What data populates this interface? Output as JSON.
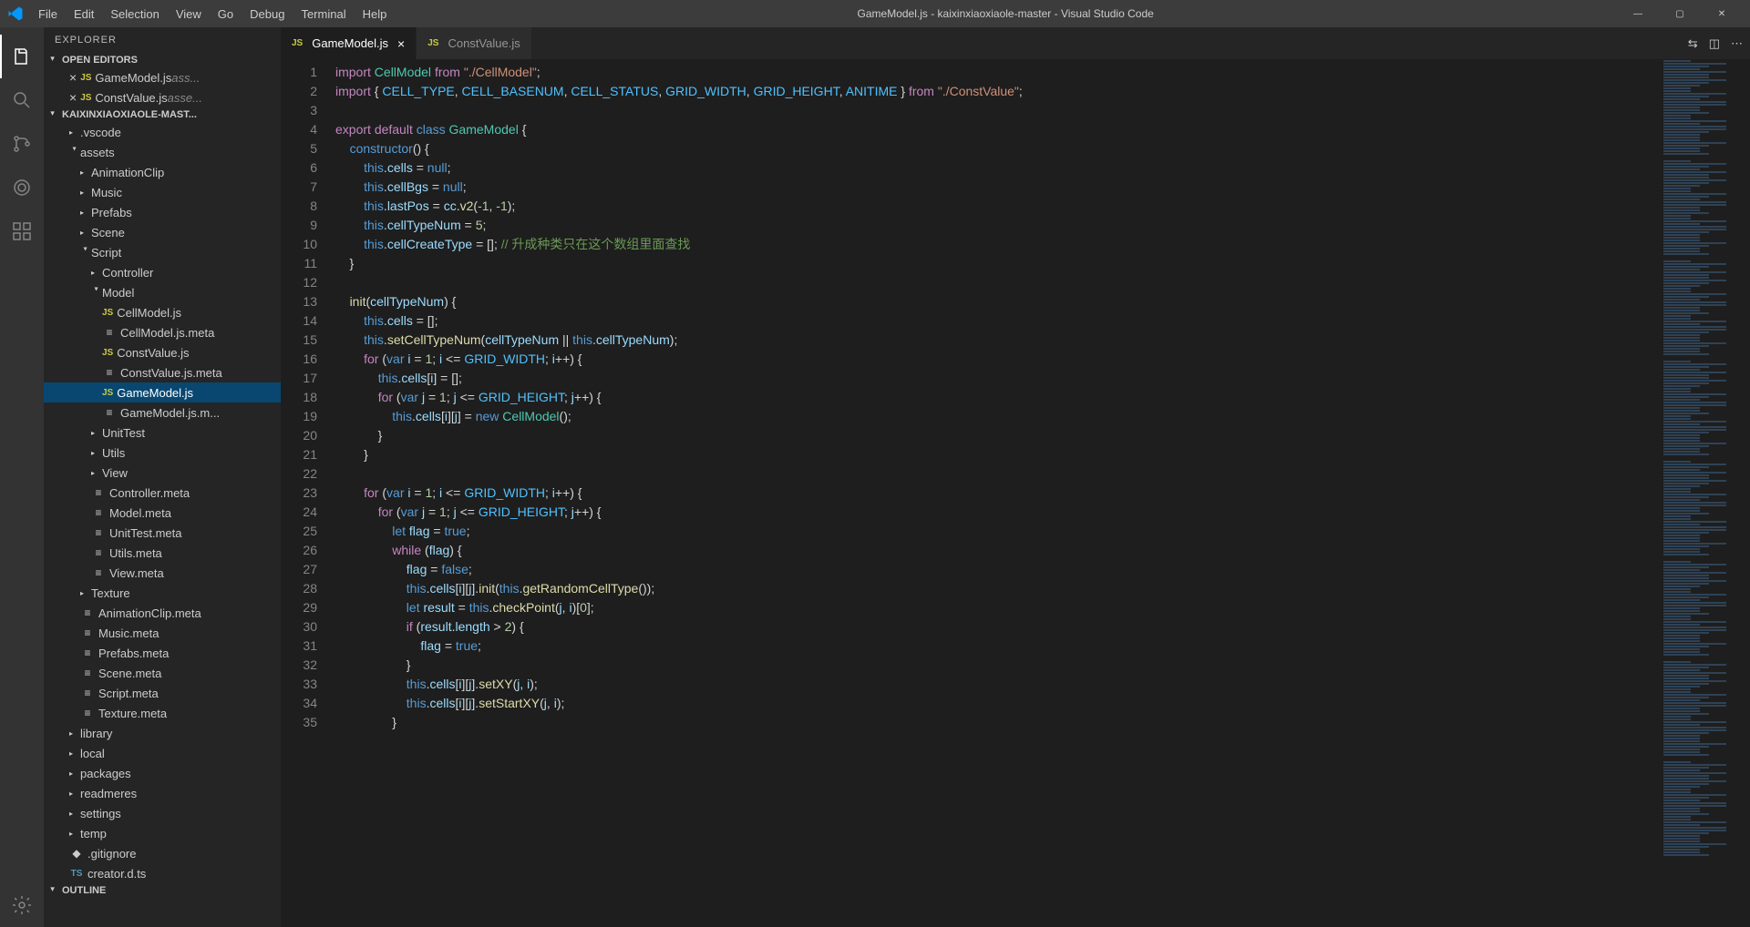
{
  "title": "GameModel.js - kaixinxiaoxiaole-master - Visual Studio Code",
  "menu": [
    "File",
    "Edit",
    "Selection",
    "View",
    "Go",
    "Debug",
    "Terminal",
    "Help"
  ],
  "winControls": [
    "—",
    "▢",
    "✕"
  ],
  "sidebar": {
    "title": "EXPLORER",
    "sections": {
      "openEditors": "OPEN EDITORS",
      "project": "KAIXINXIAOXIAOLE-MAST...",
      "outline": "OUTLINE"
    },
    "openEditors": [
      {
        "name": "GameModel.js",
        "suffix": "ass..."
      },
      {
        "name": "ConstValue.js",
        "suffix": "asse..."
      }
    ],
    "tree": [
      {
        "d": 1,
        "t": "folder",
        "open": false,
        "name": ".vscode"
      },
      {
        "d": 1,
        "t": "folder",
        "open": true,
        "name": "assets"
      },
      {
        "d": 2,
        "t": "folder",
        "open": false,
        "name": "AnimationClip"
      },
      {
        "d": 2,
        "t": "folder",
        "open": false,
        "name": "Music"
      },
      {
        "d": 2,
        "t": "folder",
        "open": false,
        "name": "Prefabs"
      },
      {
        "d": 2,
        "t": "folder",
        "open": false,
        "name": "Scene"
      },
      {
        "d": 2,
        "t": "folder",
        "open": true,
        "name": "Script"
      },
      {
        "d": 3,
        "t": "folder",
        "open": false,
        "name": "Controller"
      },
      {
        "d": 3,
        "t": "folder",
        "open": true,
        "name": "Model"
      },
      {
        "d": 4,
        "t": "js",
        "name": "CellModel.js"
      },
      {
        "d": 4,
        "t": "meta",
        "name": "CellModel.js.meta"
      },
      {
        "d": 4,
        "t": "js",
        "name": "ConstValue.js"
      },
      {
        "d": 4,
        "t": "meta",
        "name": "ConstValue.js.meta"
      },
      {
        "d": 4,
        "t": "js",
        "name": "GameModel.js",
        "selected": true
      },
      {
        "d": 4,
        "t": "meta",
        "name": "GameModel.js.m..."
      },
      {
        "d": 3,
        "t": "folder",
        "open": false,
        "name": "UnitTest"
      },
      {
        "d": 3,
        "t": "folder",
        "open": false,
        "name": "Utils"
      },
      {
        "d": 3,
        "t": "folder",
        "open": false,
        "name": "View"
      },
      {
        "d": 3,
        "t": "meta",
        "name": "Controller.meta"
      },
      {
        "d": 3,
        "t": "meta",
        "name": "Model.meta"
      },
      {
        "d": 3,
        "t": "meta",
        "name": "UnitTest.meta"
      },
      {
        "d": 3,
        "t": "meta",
        "name": "Utils.meta"
      },
      {
        "d": 3,
        "t": "meta",
        "name": "View.meta"
      },
      {
        "d": 2,
        "t": "folder",
        "open": false,
        "name": "Texture"
      },
      {
        "d": 2,
        "t": "meta",
        "name": "AnimationClip.meta"
      },
      {
        "d": 2,
        "t": "meta",
        "name": "Music.meta"
      },
      {
        "d": 2,
        "t": "meta",
        "name": "Prefabs.meta"
      },
      {
        "d": 2,
        "t": "meta",
        "name": "Scene.meta"
      },
      {
        "d": 2,
        "t": "meta",
        "name": "Script.meta"
      },
      {
        "d": 2,
        "t": "meta",
        "name": "Texture.meta"
      },
      {
        "d": 1,
        "t": "folder",
        "open": false,
        "name": "library"
      },
      {
        "d": 1,
        "t": "folder",
        "open": false,
        "name": "local"
      },
      {
        "d": 1,
        "t": "folder",
        "open": false,
        "name": "packages"
      },
      {
        "d": 1,
        "t": "folder",
        "open": false,
        "name": "readmeres"
      },
      {
        "d": 1,
        "t": "folder",
        "open": false,
        "name": "settings"
      },
      {
        "d": 1,
        "t": "folder",
        "open": false,
        "name": "temp"
      },
      {
        "d": 1,
        "t": "file",
        "name": ".gitignore"
      },
      {
        "d": 1,
        "t": "ts",
        "name": "creator.d.ts"
      }
    ]
  },
  "tabs": [
    {
      "name": "GameModel.js",
      "active": true
    },
    {
      "name": "ConstValue.js",
      "active": false
    }
  ],
  "code": {
    "lines": [
      [
        {
          "c": "kw",
          "t": "import"
        },
        {
          "t": " "
        },
        {
          "c": "cls",
          "t": "CellModel"
        },
        {
          "t": " "
        },
        {
          "c": "kw",
          "t": "from"
        },
        {
          "t": " "
        },
        {
          "c": "str",
          "t": "\"./CellModel\""
        },
        {
          "t": ";"
        }
      ],
      [
        {
          "c": "kw",
          "t": "import"
        },
        {
          "t": " { "
        },
        {
          "c": "const",
          "t": "CELL_TYPE"
        },
        {
          "t": ", "
        },
        {
          "c": "const",
          "t": "CELL_BASENUM"
        },
        {
          "t": ", "
        },
        {
          "c": "const",
          "t": "CELL_STATUS"
        },
        {
          "t": ", "
        },
        {
          "c": "const",
          "t": "GRID_WIDTH"
        },
        {
          "t": ", "
        },
        {
          "c": "const",
          "t": "GRID_HEIGHT"
        },
        {
          "t": ", "
        },
        {
          "c": "const",
          "t": "ANITIME"
        },
        {
          "t": " } "
        },
        {
          "c": "kw",
          "t": "from"
        },
        {
          "t": " "
        },
        {
          "c": "str",
          "t": "\"./ConstValue\""
        },
        {
          "t": ";"
        }
      ],
      [],
      [
        {
          "c": "kw",
          "t": "export"
        },
        {
          "t": " "
        },
        {
          "c": "kw",
          "t": "default"
        },
        {
          "t": " "
        },
        {
          "c": "kw2",
          "t": "class"
        },
        {
          "t": " "
        },
        {
          "c": "cls",
          "t": "GameModel"
        },
        {
          "t": " {"
        }
      ],
      [
        {
          "t": "    "
        },
        {
          "c": "kw2",
          "t": "constructor"
        },
        {
          "t": "() {"
        }
      ],
      [
        {
          "t": "        "
        },
        {
          "c": "kw2",
          "t": "this"
        },
        {
          "t": "."
        },
        {
          "c": "prop",
          "t": "cells"
        },
        {
          "t": " = "
        },
        {
          "c": "kw2",
          "t": "null"
        },
        {
          "t": ";"
        }
      ],
      [
        {
          "t": "        "
        },
        {
          "c": "kw2",
          "t": "this"
        },
        {
          "t": "."
        },
        {
          "c": "prop",
          "t": "cellBgs"
        },
        {
          "t": " = "
        },
        {
          "c": "kw2",
          "t": "null"
        },
        {
          "t": ";"
        }
      ],
      [
        {
          "t": "        "
        },
        {
          "c": "kw2",
          "t": "this"
        },
        {
          "t": "."
        },
        {
          "c": "prop",
          "t": "lastPos"
        },
        {
          "t": " = "
        },
        {
          "c": "prop",
          "t": "cc"
        },
        {
          "t": "."
        },
        {
          "c": "fn",
          "t": "v2"
        },
        {
          "t": "("
        },
        {
          "c": "num",
          "t": "-1"
        },
        {
          "t": ", "
        },
        {
          "c": "num",
          "t": "-1"
        },
        {
          "t": ");"
        }
      ],
      [
        {
          "t": "        "
        },
        {
          "c": "kw2",
          "t": "this"
        },
        {
          "t": "."
        },
        {
          "c": "prop",
          "t": "cellTypeNum"
        },
        {
          "t": " = "
        },
        {
          "c": "num",
          "t": "5"
        },
        {
          "t": ";"
        }
      ],
      [
        {
          "t": "        "
        },
        {
          "c": "kw2",
          "t": "this"
        },
        {
          "t": "."
        },
        {
          "c": "prop",
          "t": "cellCreateType"
        },
        {
          "t": " = []; "
        },
        {
          "c": "cmt",
          "t": "// 升成种类只在这个数组里面查找"
        }
      ],
      [
        {
          "t": "    }"
        }
      ],
      [],
      [
        {
          "t": "    "
        },
        {
          "c": "fn",
          "t": "init"
        },
        {
          "t": "("
        },
        {
          "c": "var",
          "t": "cellTypeNum"
        },
        {
          "t": ") {"
        }
      ],
      [
        {
          "t": "        "
        },
        {
          "c": "kw2",
          "t": "this"
        },
        {
          "t": "."
        },
        {
          "c": "prop",
          "t": "cells"
        },
        {
          "t": " = [];"
        }
      ],
      [
        {
          "t": "        "
        },
        {
          "c": "kw2",
          "t": "this"
        },
        {
          "t": "."
        },
        {
          "c": "fn",
          "t": "setCellTypeNum"
        },
        {
          "t": "("
        },
        {
          "c": "var",
          "t": "cellTypeNum"
        },
        {
          "t": " || "
        },
        {
          "c": "kw2",
          "t": "this"
        },
        {
          "t": "."
        },
        {
          "c": "prop",
          "t": "cellTypeNum"
        },
        {
          "t": ");"
        }
      ],
      [
        {
          "t": "        "
        },
        {
          "c": "kw",
          "t": "for"
        },
        {
          "t": " ("
        },
        {
          "c": "kw2",
          "t": "var"
        },
        {
          "t": " "
        },
        {
          "c": "var",
          "t": "i"
        },
        {
          "t": " = "
        },
        {
          "c": "num",
          "t": "1"
        },
        {
          "t": "; "
        },
        {
          "c": "var",
          "t": "i"
        },
        {
          "t": " <= "
        },
        {
          "c": "const",
          "t": "GRID_WIDTH"
        },
        {
          "t": "; "
        },
        {
          "c": "var",
          "t": "i"
        },
        {
          "t": "++) {"
        }
      ],
      [
        {
          "t": "            "
        },
        {
          "c": "kw2",
          "t": "this"
        },
        {
          "t": "."
        },
        {
          "c": "prop",
          "t": "cells"
        },
        {
          "t": "["
        },
        {
          "c": "var",
          "t": "i"
        },
        {
          "t": "] = [];"
        }
      ],
      [
        {
          "t": "            "
        },
        {
          "c": "kw",
          "t": "for"
        },
        {
          "t": " ("
        },
        {
          "c": "kw2",
          "t": "var"
        },
        {
          "t": " "
        },
        {
          "c": "var",
          "t": "j"
        },
        {
          "t": " = "
        },
        {
          "c": "num",
          "t": "1"
        },
        {
          "t": "; "
        },
        {
          "c": "var",
          "t": "j"
        },
        {
          "t": " <= "
        },
        {
          "c": "const",
          "t": "GRID_HEIGHT"
        },
        {
          "t": "; "
        },
        {
          "c": "var",
          "t": "j"
        },
        {
          "t": "++) {"
        }
      ],
      [
        {
          "t": "                "
        },
        {
          "c": "kw2",
          "t": "this"
        },
        {
          "t": "."
        },
        {
          "c": "prop",
          "t": "cells"
        },
        {
          "t": "["
        },
        {
          "c": "var",
          "t": "i"
        },
        {
          "t": "]["
        },
        {
          "c": "var",
          "t": "j"
        },
        {
          "t": "] = "
        },
        {
          "c": "kw2",
          "t": "new"
        },
        {
          "t": " "
        },
        {
          "c": "cls",
          "t": "CellModel"
        },
        {
          "t": "();"
        }
      ],
      [
        {
          "t": "            }"
        }
      ],
      [
        {
          "t": "        }"
        }
      ],
      [],
      [
        {
          "t": "        "
        },
        {
          "c": "kw",
          "t": "for"
        },
        {
          "t": " ("
        },
        {
          "c": "kw2",
          "t": "var"
        },
        {
          "t": " "
        },
        {
          "c": "var",
          "t": "i"
        },
        {
          "t": " = "
        },
        {
          "c": "num",
          "t": "1"
        },
        {
          "t": "; "
        },
        {
          "c": "var",
          "t": "i"
        },
        {
          "t": " <= "
        },
        {
          "c": "const",
          "t": "GRID_WIDTH"
        },
        {
          "t": "; "
        },
        {
          "c": "var",
          "t": "i"
        },
        {
          "t": "++) {"
        }
      ],
      [
        {
          "t": "            "
        },
        {
          "c": "kw",
          "t": "for"
        },
        {
          "t": " ("
        },
        {
          "c": "kw2",
          "t": "var"
        },
        {
          "t": " "
        },
        {
          "c": "var",
          "t": "j"
        },
        {
          "t": " = "
        },
        {
          "c": "num",
          "t": "1"
        },
        {
          "t": "; "
        },
        {
          "c": "var",
          "t": "j"
        },
        {
          "t": " <= "
        },
        {
          "c": "const",
          "t": "GRID_HEIGHT"
        },
        {
          "t": "; "
        },
        {
          "c": "var",
          "t": "j"
        },
        {
          "t": "++) {"
        }
      ],
      [
        {
          "t": "                "
        },
        {
          "c": "kw2",
          "t": "let"
        },
        {
          "t": " "
        },
        {
          "c": "var",
          "t": "flag"
        },
        {
          "t": " = "
        },
        {
          "c": "kw2",
          "t": "true"
        },
        {
          "t": ";"
        }
      ],
      [
        {
          "t": "                "
        },
        {
          "c": "kw",
          "t": "while"
        },
        {
          "t": " ("
        },
        {
          "c": "var",
          "t": "flag"
        },
        {
          "t": ") {"
        }
      ],
      [
        {
          "t": "                    "
        },
        {
          "c": "var",
          "t": "flag"
        },
        {
          "t": " = "
        },
        {
          "c": "kw2",
          "t": "false"
        },
        {
          "t": ";"
        }
      ],
      [
        {
          "t": "                    "
        },
        {
          "c": "kw2",
          "t": "this"
        },
        {
          "t": "."
        },
        {
          "c": "prop",
          "t": "cells"
        },
        {
          "t": "["
        },
        {
          "c": "var",
          "t": "i"
        },
        {
          "t": "]["
        },
        {
          "c": "var",
          "t": "j"
        },
        {
          "t": "]."
        },
        {
          "c": "fn",
          "t": "init"
        },
        {
          "t": "("
        },
        {
          "c": "kw2",
          "t": "this"
        },
        {
          "t": "."
        },
        {
          "c": "fn",
          "t": "getRandomCellType"
        },
        {
          "t": "());"
        }
      ],
      [
        {
          "t": "                    "
        },
        {
          "c": "kw2",
          "t": "let"
        },
        {
          "t": " "
        },
        {
          "c": "var",
          "t": "result"
        },
        {
          "t": " = "
        },
        {
          "c": "kw2",
          "t": "this"
        },
        {
          "t": "."
        },
        {
          "c": "fn",
          "t": "checkPoint"
        },
        {
          "t": "("
        },
        {
          "c": "var",
          "t": "j"
        },
        {
          "t": ", "
        },
        {
          "c": "var",
          "t": "i"
        },
        {
          "t": ")["
        },
        {
          "c": "num",
          "t": "0"
        },
        {
          "t": "];"
        }
      ],
      [
        {
          "t": "                    "
        },
        {
          "c": "kw",
          "t": "if"
        },
        {
          "t": " ("
        },
        {
          "c": "var",
          "t": "result"
        },
        {
          "t": "."
        },
        {
          "c": "prop",
          "t": "length"
        },
        {
          "t": " > "
        },
        {
          "c": "num",
          "t": "2"
        },
        {
          "t": ") {"
        }
      ],
      [
        {
          "t": "                        "
        },
        {
          "c": "var",
          "t": "flag"
        },
        {
          "t": " = "
        },
        {
          "c": "kw2",
          "t": "true"
        },
        {
          "t": ";"
        }
      ],
      [
        {
          "t": "                    }"
        }
      ],
      [
        {
          "t": "                    "
        },
        {
          "c": "kw2",
          "t": "this"
        },
        {
          "t": "."
        },
        {
          "c": "prop",
          "t": "cells"
        },
        {
          "t": "["
        },
        {
          "c": "var",
          "t": "i"
        },
        {
          "t": "]["
        },
        {
          "c": "var",
          "t": "j"
        },
        {
          "t": "]."
        },
        {
          "c": "fn",
          "t": "setXY"
        },
        {
          "t": "("
        },
        {
          "c": "var",
          "t": "j"
        },
        {
          "t": ", "
        },
        {
          "c": "var",
          "t": "i"
        },
        {
          "t": ");"
        }
      ],
      [
        {
          "t": "                    "
        },
        {
          "c": "kw2",
          "t": "this"
        },
        {
          "t": "."
        },
        {
          "c": "prop",
          "t": "cells"
        },
        {
          "t": "["
        },
        {
          "c": "var",
          "t": "i"
        },
        {
          "t": "]["
        },
        {
          "c": "var",
          "t": "j"
        },
        {
          "t": "]."
        },
        {
          "c": "fn",
          "t": "setStartXY"
        },
        {
          "t": "("
        },
        {
          "c": "var",
          "t": "j"
        },
        {
          "t": ", "
        },
        {
          "c": "var",
          "t": "i"
        },
        {
          "t": ");"
        }
      ],
      [
        {
          "t": "                }"
        }
      ]
    ]
  }
}
